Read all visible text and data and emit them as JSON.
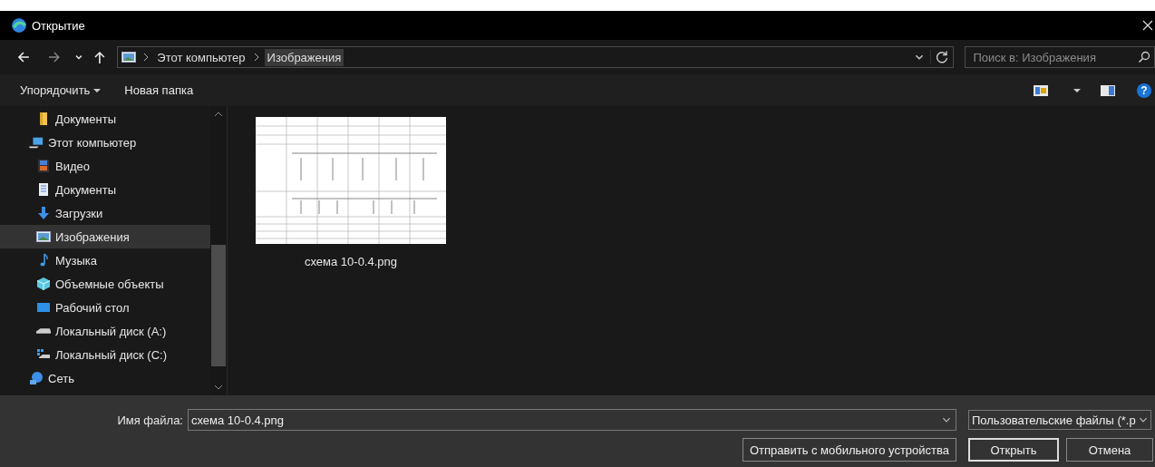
{
  "window": {
    "title": "Открытие"
  },
  "address_bar": {
    "crumbs": [
      {
        "label": "Этот компьютер",
        "selected": false
      },
      {
        "label": "Изображения",
        "selected": true
      }
    ]
  },
  "search": {
    "placeholder": "Поиск в: Изображения"
  },
  "toolbar": {
    "organize": "Упорядочить",
    "new_folder": "Новая папка",
    "help": "?"
  },
  "sidebar": {
    "items": [
      {
        "label": "Документы",
        "kind": "folder",
        "selected": false
      },
      {
        "label": "Этот компьютер",
        "kind": "computer",
        "selected": false,
        "children": [
          {
            "label": "Видео",
            "kind": "video",
            "selected": false
          },
          {
            "label": "Документы",
            "kind": "docs",
            "selected": false
          },
          {
            "label": "Загрузки",
            "kind": "download",
            "selected": false
          },
          {
            "label": "Изображения",
            "kind": "pictures",
            "selected": true
          },
          {
            "label": "Музыка",
            "kind": "music",
            "selected": false
          },
          {
            "label": "Объемные объекты",
            "kind": "cube",
            "selected": false
          },
          {
            "label": "Рабочий стол",
            "kind": "desktop",
            "selected": false
          },
          {
            "label": "Локальный диск (A:)",
            "kind": "drive",
            "selected": false
          },
          {
            "label": "Локальный диск (C:)",
            "kind": "sysdrive",
            "selected": false
          }
        ]
      },
      {
        "label": "Сеть",
        "kind": "network",
        "selected": false
      }
    ]
  },
  "files": [
    {
      "name": "схема 10-0.4.png"
    }
  ],
  "footer": {
    "filename_label": "Имя файла:",
    "filename_value": "схема 10-0.4.png",
    "filetype": "Пользовательские файлы (*.p",
    "buttons": [
      {
        "label": "Отправить с мобильного устройства",
        "default": false
      },
      {
        "label": "Открыть",
        "default": true
      },
      {
        "label": "Отмена",
        "default": false
      }
    ]
  }
}
